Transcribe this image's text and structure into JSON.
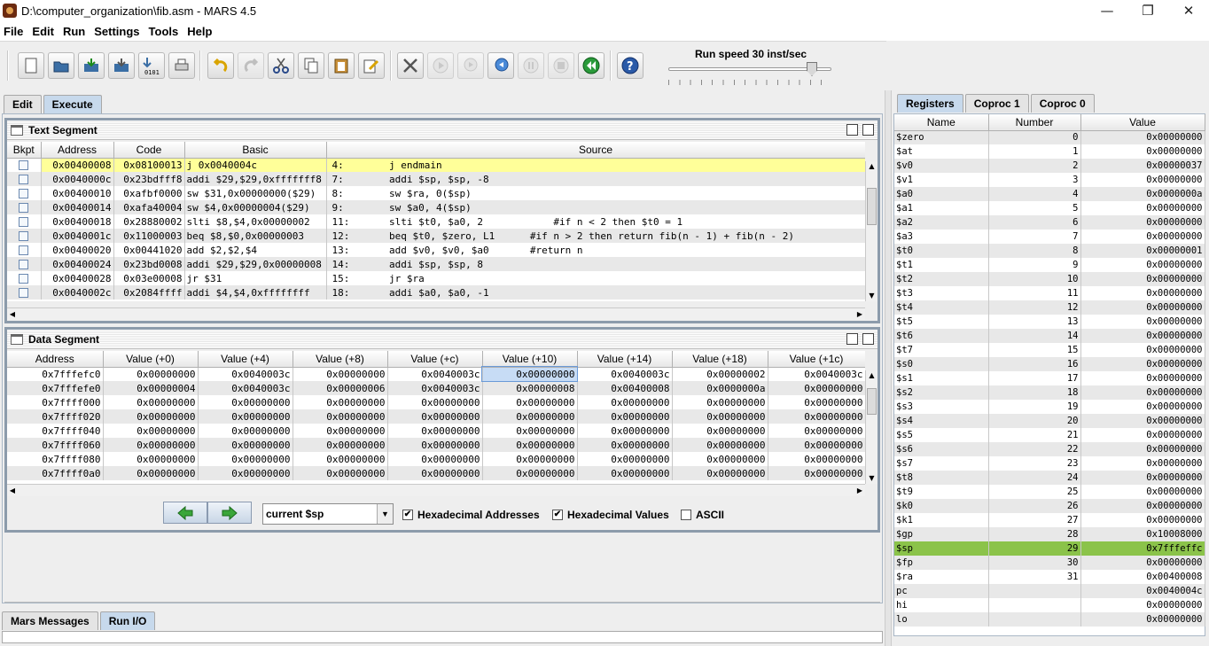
{
  "window": {
    "title": "D:\\computer_organization\\fib.asm  - MARS 4.5"
  },
  "menu": [
    "File",
    "Edit",
    "Run",
    "Settings",
    "Tools",
    "Help"
  ],
  "toolbar": {
    "speed_label": "Run speed 30 inst/sec",
    "speed_level": 30
  },
  "main_tabs": [
    {
      "label": "Edit"
    },
    {
      "label": "Execute",
      "selected": true
    }
  ],
  "text_segment": {
    "title": "Text Segment",
    "headers": [
      "Bkpt",
      "Address",
      "Code",
      "Basic",
      "Source"
    ],
    "rows": [
      {
        "address": "0x00400008",
        "code": "0x08100013",
        "basic": "j 0x0040004c",
        "line": "4:",
        "source": "    j endmain",
        "highlight": true
      },
      {
        "address": "0x0040000c",
        "code": "0x23bdfff8",
        "basic": "addi $29,$29,0xfffffff8",
        "line": "7:",
        "source": "    addi $sp, $sp, -8"
      },
      {
        "address": "0x00400010",
        "code": "0xafbf0000",
        "basic": "sw $31,0x00000000($29)",
        "line": "8:",
        "source": "    sw $ra, 0($sp)"
      },
      {
        "address": "0x00400014",
        "code": "0xafa40004",
        "basic": "sw $4,0x00000004($29)",
        "line": "9:",
        "source": "    sw $a0, 4($sp)"
      },
      {
        "address": "0x00400018",
        "code": "0x28880002",
        "basic": "slti $8,$4,0x00000002",
        "line": "11:",
        "source": "    slti $t0, $a0, 2            #if n < 2 then $t0 = 1"
      },
      {
        "address": "0x0040001c",
        "code": "0x11000003",
        "basic": "beq $8,$0,0x00000003",
        "line": "12:",
        "source": "    beq $t0, $zero, L1      #if n > 2 then return fib(n - 1) + fib(n - 2)"
      },
      {
        "address": "0x00400020",
        "code": "0x00441020",
        "basic": "add $2,$2,$4",
        "line": "13:",
        "source": "    add $v0, $v0, $a0       #return n"
      },
      {
        "address": "0x00400024",
        "code": "0x23bd0008",
        "basic": "addi $29,$29,0x00000008",
        "line": "14:",
        "source": "    addi $sp, $sp, 8"
      },
      {
        "address": "0x00400028",
        "code": "0x03e00008",
        "basic": "jr $31",
        "line": "15:",
        "source": "    jr $ra"
      },
      {
        "address": "0x0040002c",
        "code": "0x2084ffff",
        "basic": "addi $4,$4,0xffffffff",
        "line": "18:",
        "source": "    addi $a0, $a0, -1"
      }
    ]
  },
  "data_segment": {
    "title": "Data Segment",
    "headers": [
      "Address",
      "Value (+0)",
      "Value (+4)",
      "Value (+8)",
      "Value (+c)",
      "Value (+10)",
      "Value (+14)",
      "Value (+18)",
      "Value (+1c)"
    ],
    "rows": [
      [
        "0x7fffefc0",
        "0x00000000",
        "0x0040003c",
        "0x00000000",
        "0x0040003c",
        "0x00000000",
        "0x0040003c",
        "0x00000002",
        "0x0040003c"
      ],
      [
        "0x7fffefe0",
        "0x00000004",
        "0x0040003c",
        "0x00000006",
        "0x0040003c",
        "0x00000008",
        "0x00400008",
        "0x0000000a",
        "0x00000000"
      ],
      [
        "0x7ffff000",
        "0x00000000",
        "0x00000000",
        "0x00000000",
        "0x00000000",
        "0x00000000",
        "0x00000000",
        "0x00000000",
        "0x00000000"
      ],
      [
        "0x7ffff020",
        "0x00000000",
        "0x00000000",
        "0x00000000",
        "0x00000000",
        "0x00000000",
        "0x00000000",
        "0x00000000",
        "0x00000000"
      ],
      [
        "0x7ffff040",
        "0x00000000",
        "0x00000000",
        "0x00000000",
        "0x00000000",
        "0x00000000",
        "0x00000000",
        "0x00000000",
        "0x00000000"
      ],
      [
        "0x7ffff060",
        "0x00000000",
        "0x00000000",
        "0x00000000",
        "0x00000000",
        "0x00000000",
        "0x00000000",
        "0x00000000",
        "0x00000000"
      ],
      [
        "0x7ffff080",
        "0x00000000",
        "0x00000000",
        "0x00000000",
        "0x00000000",
        "0x00000000",
        "0x00000000",
        "0x00000000",
        "0x00000000"
      ],
      [
        "0x7ffff0a0",
        "0x00000000",
        "0x00000000",
        "0x00000000",
        "0x00000000",
        "0x00000000",
        "0x00000000",
        "0x00000000",
        "0x00000000"
      ]
    ],
    "selected_cell": [
      0,
      5
    ],
    "combo_value": "current $sp",
    "hex_addresses_label": "Hexadecimal Addresses",
    "hex_values_label": "Hexadecimal Values",
    "ascii_label": "ASCII",
    "hex_addresses_checked": true,
    "hex_values_checked": true,
    "ascii_checked": false
  },
  "register_tabs": [
    {
      "label": "Registers",
      "selected": true
    },
    {
      "label": "Coproc 1"
    },
    {
      "label": "Coproc 0"
    }
  ],
  "registers": {
    "headers": [
      "Name",
      "Number",
      "Value"
    ],
    "rows": [
      [
        "$zero",
        "0",
        "0x00000000"
      ],
      [
        "$at",
        "1",
        "0x00000000"
      ],
      [
        "$v0",
        "2",
        "0x00000037"
      ],
      [
        "$v1",
        "3",
        "0x00000000"
      ],
      [
        "$a0",
        "4",
        "0x0000000a"
      ],
      [
        "$a1",
        "5",
        "0x00000000"
      ],
      [
        "$a2",
        "6",
        "0x00000000"
      ],
      [
        "$a3",
        "7",
        "0x00000000"
      ],
      [
        "$t0",
        "8",
        "0x00000001"
      ],
      [
        "$t1",
        "9",
        "0x00000000"
      ],
      [
        "$t2",
        "10",
        "0x00000000"
      ],
      [
        "$t3",
        "11",
        "0x00000000"
      ],
      [
        "$t4",
        "12",
        "0x00000000"
      ],
      [
        "$t5",
        "13",
        "0x00000000"
      ],
      [
        "$t6",
        "14",
        "0x00000000"
      ],
      [
        "$t7",
        "15",
        "0x00000000"
      ],
      [
        "$s0",
        "16",
        "0x00000000"
      ],
      [
        "$s1",
        "17",
        "0x00000000"
      ],
      [
        "$s2",
        "18",
        "0x00000000"
      ],
      [
        "$s3",
        "19",
        "0x00000000"
      ],
      [
        "$s4",
        "20",
        "0x00000000"
      ],
      [
        "$s5",
        "21",
        "0x00000000"
      ],
      [
        "$s6",
        "22",
        "0x00000000"
      ],
      [
        "$s7",
        "23",
        "0x00000000"
      ],
      [
        "$t8",
        "24",
        "0x00000000"
      ],
      [
        "$t9",
        "25",
        "0x00000000"
      ],
      [
        "$k0",
        "26",
        "0x00000000"
      ],
      [
        "$k1",
        "27",
        "0x00000000"
      ],
      [
        "$gp",
        "28",
        "0x10008000"
      ],
      [
        "$sp",
        "29",
        "0x7fffeffc"
      ],
      [
        "$fp",
        "30",
        "0x00000000"
      ],
      [
        "$ra",
        "31",
        "0x00400008"
      ],
      [
        "pc",
        "",
        "0x0040004c"
      ],
      [
        "hi",
        "",
        "0x00000000"
      ],
      [
        "lo",
        "",
        "0x00000000"
      ]
    ],
    "highlighted_row": 29
  },
  "bottom_tabs": [
    {
      "label": "Mars Messages"
    },
    {
      "label": "Run I/O",
      "selected": true
    }
  ],
  "colors": {
    "highlight_yellow": "#ffff99",
    "highlight_green": "#8bc34a",
    "selected_cell": "#c7dcf5",
    "tab_selected": "#c7d9ec"
  }
}
